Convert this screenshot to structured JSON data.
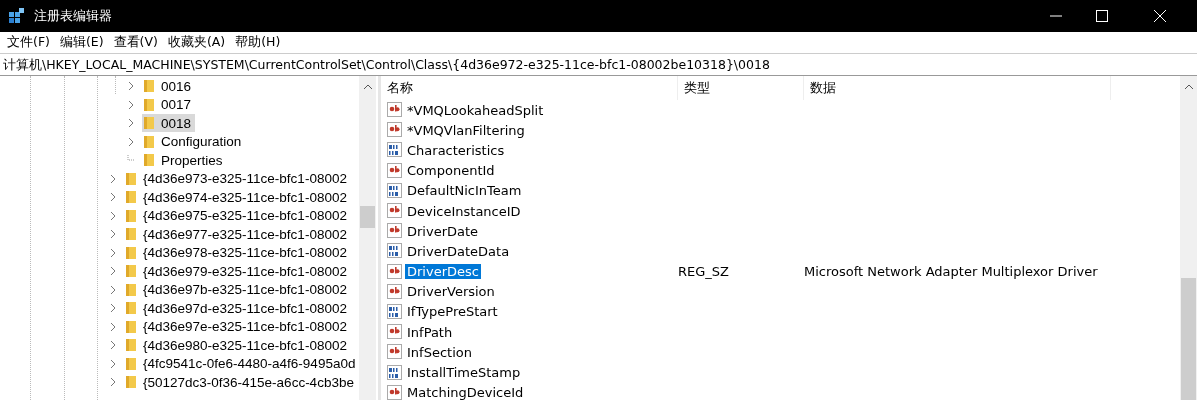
{
  "window": {
    "title": "注册表编辑器"
  },
  "menu": [
    "文件(F)",
    "编辑(E)",
    "查看(V)",
    "收藏夹(A)",
    "帮助(H)"
  ],
  "address": "计算机\\HKEY_LOCAL_MACHINE\\SYSTEM\\CurrentControlSet\\Control\\Class\\{4d36e972-e325-11ce-bfc1-08002be10318}\\0018",
  "tree": [
    {
      "children": [
        {
          "label": "0016",
          "has_children": true,
          "selected": false
        },
        {
          "label": "0017",
          "has_children": true,
          "selected": false
        },
        {
          "label": "0018",
          "has_children": true,
          "selected": true
        },
        {
          "label": "Configuration",
          "has_children": true,
          "selected": false
        },
        {
          "label": "Properties",
          "has_children": false,
          "selected": false
        }
      ]
    },
    {
      "label": "{4d36e973-e325-11ce-bfc1-08002",
      "has_children": true,
      "selected": false
    },
    {
      "label": "{4d36e974-e325-11ce-bfc1-08002",
      "has_children": true,
      "selected": false
    },
    {
      "label": "{4d36e975-e325-11ce-bfc1-08002",
      "has_children": true,
      "selected": false
    },
    {
      "label": "{4d36e977-e325-11ce-bfc1-08002",
      "has_children": true,
      "selected": false
    },
    {
      "label": "{4d36e978-e325-11ce-bfc1-08002",
      "has_children": true,
      "selected": false
    },
    {
      "label": "{4d36e979-e325-11ce-bfc1-08002",
      "has_children": true,
      "selected": false
    },
    {
      "label": "{4d36e97b-e325-11ce-bfc1-08002",
      "has_children": true,
      "selected": false
    },
    {
      "label": "{4d36e97d-e325-11ce-bfc1-08002",
      "has_children": true,
      "selected": false
    },
    {
      "label": "{4d36e97e-e325-11ce-bfc1-08002",
      "has_children": true,
      "selected": false
    },
    {
      "label": "{4d36e980-e325-11ce-bfc1-08002",
      "has_children": true,
      "selected": false
    },
    {
      "label": "{4fc9541c-0fe6-4480-a4f6-9495a0d",
      "has_children": true,
      "selected": false
    },
    {
      "label": "{50127dc3-0f36-415e-a6cc-4cb3be",
      "has_children": true,
      "selected": false
    }
  ],
  "table": {
    "columns": [
      "名称",
      "类型",
      "数据"
    ],
    "rows": [
      {
        "name": "*VMQLookaheadSplit",
        "kind": "string",
        "selected": false
      },
      {
        "name": "*VMQVlanFiltering",
        "kind": "string",
        "selected": false
      },
      {
        "name": "Characteristics",
        "kind": "binary",
        "selected": false
      },
      {
        "name": "ComponentId",
        "kind": "string",
        "selected": false
      },
      {
        "name": "DefaultNicInTeam",
        "kind": "binary",
        "selected": false
      },
      {
        "name": "DeviceInstanceID",
        "kind": "string",
        "selected": false
      },
      {
        "name": "DriverDate",
        "kind": "string",
        "selected": false
      },
      {
        "name": "DriverDateData",
        "kind": "binary",
        "selected": false
      },
      {
        "name": "DriverDesc",
        "kind": "string",
        "selected": true,
        "type": "REG_SZ",
        "data": "Microsoft Network Adapter Multiplexor Driver"
      },
      {
        "name": "DriverVersion",
        "kind": "string",
        "selected": false
      },
      {
        "name": "IfTypePreStart",
        "kind": "binary",
        "selected": false
      },
      {
        "name": "InfPath",
        "kind": "string",
        "selected": false
      },
      {
        "name": "InfSection",
        "kind": "string",
        "selected": false
      },
      {
        "name": "InstallTimeStamp",
        "kind": "binary",
        "selected": false
      },
      {
        "name": "MatchingDeviceId",
        "kind": "string",
        "selected": false
      }
    ]
  }
}
